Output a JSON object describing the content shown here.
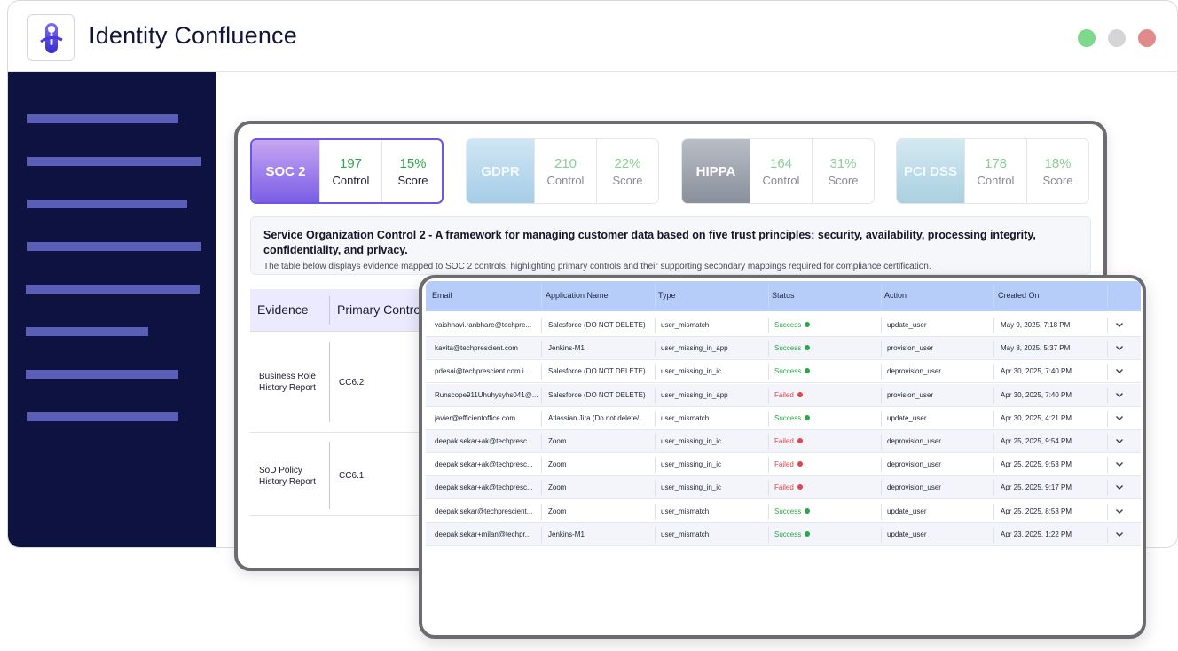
{
  "app": {
    "title": "Identity Confluence"
  },
  "window_controls": {
    "colors": [
      "#7cd98b",
      "#d5d5d8",
      "#e08a8a"
    ]
  },
  "frameworks": [
    {
      "name": "SOC 2",
      "controls": "197",
      "controls_label": "Control",
      "score": "15%",
      "score_label": "Score",
      "active": true
    },
    {
      "name": "GDPR",
      "controls": "210",
      "controls_label": "Control",
      "score": "22%",
      "score_label": "Score",
      "active": false
    },
    {
      "name": "HIPPA",
      "controls": "164",
      "controls_label": "Control",
      "score": "31%",
      "score_label": "Score",
      "active": false
    },
    {
      "name": "PCI DSS",
      "controls": "178",
      "controls_label": "Control",
      "score": "18%",
      "score_label": "Score",
      "active": false
    }
  ],
  "description": {
    "title": "Service Organization Control 2 - A framework for managing customer data based on five trust principles: security, availability, processing integrity, confidentiality, and privacy.",
    "subtitle": "The table below displays evidence mapped to SOC 2 controls, highlighting primary controls and their supporting secondary mappings required for compliance certification."
  },
  "evidence_table": {
    "headers": [
      "Evidence",
      "Primary Contro"
    ],
    "rows": [
      {
        "evidence": "Business Role History Report",
        "control": "CC6.2"
      },
      {
        "evidence": "SoD Policy History Report",
        "control": "CC6.1"
      }
    ]
  },
  "events_table": {
    "headers": [
      "Email",
      "Application Name",
      "Type",
      "Status",
      "Action",
      "Created On"
    ],
    "rows": [
      {
        "email": "vaishnavi.ranbhare@techpre...",
        "app": "Salesforce (DO NOT DELETE)",
        "type": "user_mismatch",
        "status": "Success",
        "action": "update_user",
        "created": "May 9, 2025, 7:18 PM"
      },
      {
        "email": "kavita@techprescient.com",
        "app": "Jenkins-M1",
        "type": "user_missing_in_app",
        "status": "Success",
        "action": "provision_user",
        "created": "May 8, 2025, 5:37 PM"
      },
      {
        "email": "pdesai@techprescient.com.i...",
        "app": "Salesforce (DO NOT DELETE)",
        "type": "user_missing_in_ic",
        "status": "Success",
        "action": "deprovision_user",
        "created": "Apr 30, 2025, 7:40 PM"
      },
      {
        "email": "Runscope911Uhuhysyhs041@...",
        "app": "Salesforce (DO NOT DELETE)",
        "type": "user_missing_in_app",
        "status": "Failed",
        "action": "provision_user",
        "created": "Apr 30, 2025, 7:40 PM"
      },
      {
        "email": "javier@efficientoffice.com",
        "app": "Atlassian Jira (Do not delete/...",
        "type": "user_mismatch",
        "status": "Success",
        "action": "update_user",
        "created": "Apr 30, 2025, 4:21 PM"
      },
      {
        "email": "deepak.sekar+ak@techpresc...",
        "app": "Zoom",
        "type": "user_missing_in_ic",
        "status": "Failed",
        "action": "deprovision_user",
        "created": "Apr 25, 2025, 9:54 PM"
      },
      {
        "email": "deepak.sekar+ak@techpresc...",
        "app": "Zoom",
        "type": "user_missing_in_ic",
        "status": "Failed",
        "action": "deprovision_user",
        "created": "Apr 25, 2025, 9:53 PM"
      },
      {
        "email": "deepak.sekar+ak@techpresc...",
        "app": "Zoom",
        "type": "user_missing_in_ic",
        "status": "Failed",
        "action": "deprovision_user",
        "created": "Apr 25, 2025, 9:17 PM"
      },
      {
        "email": "deepak.sekar@techprescient...",
        "app": "Zoom",
        "type": "user_mismatch",
        "status": "Success",
        "action": "update_user",
        "created": "Apr 25, 2025, 8:53 PM"
      },
      {
        "email": "deepak.sekar+milan@techpr...",
        "app": "Jenkins-M1",
        "type": "user_mismatch",
        "status": "Success",
        "action": "update_user",
        "created": "Apr 23, 2025, 1:22 PM"
      }
    ]
  }
}
